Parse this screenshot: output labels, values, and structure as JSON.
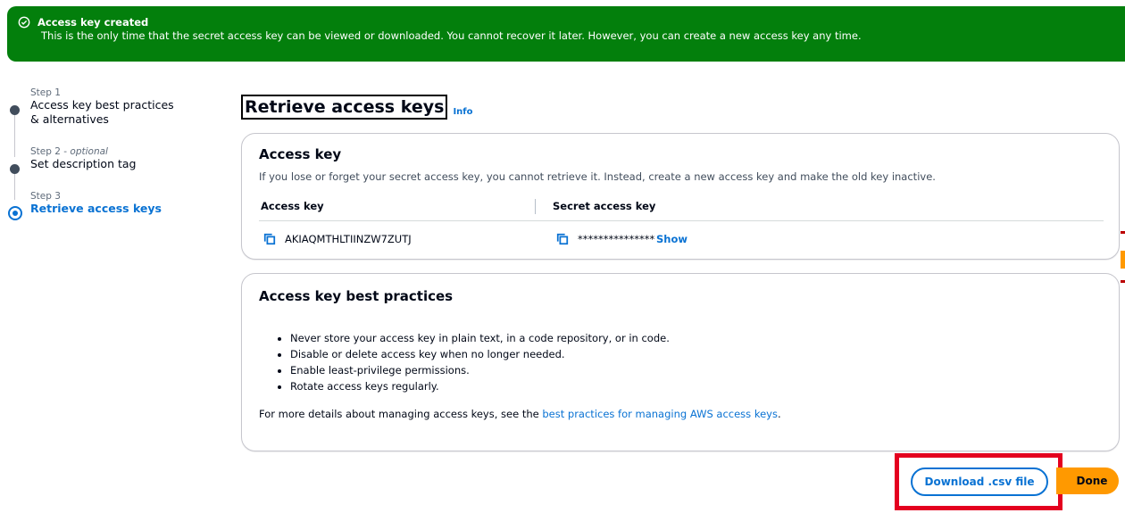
{
  "flash": {
    "title": "Access key created",
    "message": "This is the only time that the secret access key can be viewed or downloaded. You cannot recover it later. However, you can create a new access key any time."
  },
  "steps": [
    {
      "num": "Step 1",
      "title": "Access key best practices & alternatives"
    },
    {
      "num": "Step 2",
      "optional": "optional",
      "title": "Set description tag"
    },
    {
      "num": "Step 3",
      "title": "Retrieve access keys",
      "active": true
    }
  ],
  "page": {
    "title": "Retrieve access keys",
    "info": "Info"
  },
  "access_key_card": {
    "heading": "Access key",
    "description": "If you lose or forget your secret access key, you cannot retrieve it. Instead, create a new access key and make the old key inactive.",
    "col_access_key": "Access key",
    "col_secret_key": "Secret access key",
    "access_key_value": "AKIAQMTHLTIINZW7ZUTJ",
    "secret_key_masked": "***************",
    "show_label": "Show"
  },
  "best_practices_card": {
    "heading": "Access key best practices",
    "items": [
      "Never store your access key in plain text, in a code repository, or in code.",
      "Disable or delete access key when no longer needed.",
      "Enable least-privilege permissions.",
      "Rotate access keys regularly."
    ],
    "details_prefix": "For more details about managing access keys, see the ",
    "details_link": "best practices for managing AWS access keys",
    "details_suffix": "."
  },
  "actions": {
    "download": "Download .csv file",
    "done": "Done"
  },
  "colors": {
    "success": "#037f0c",
    "link": "#0972d3",
    "primary": "#ff9900",
    "highlight": "#e4001f"
  }
}
